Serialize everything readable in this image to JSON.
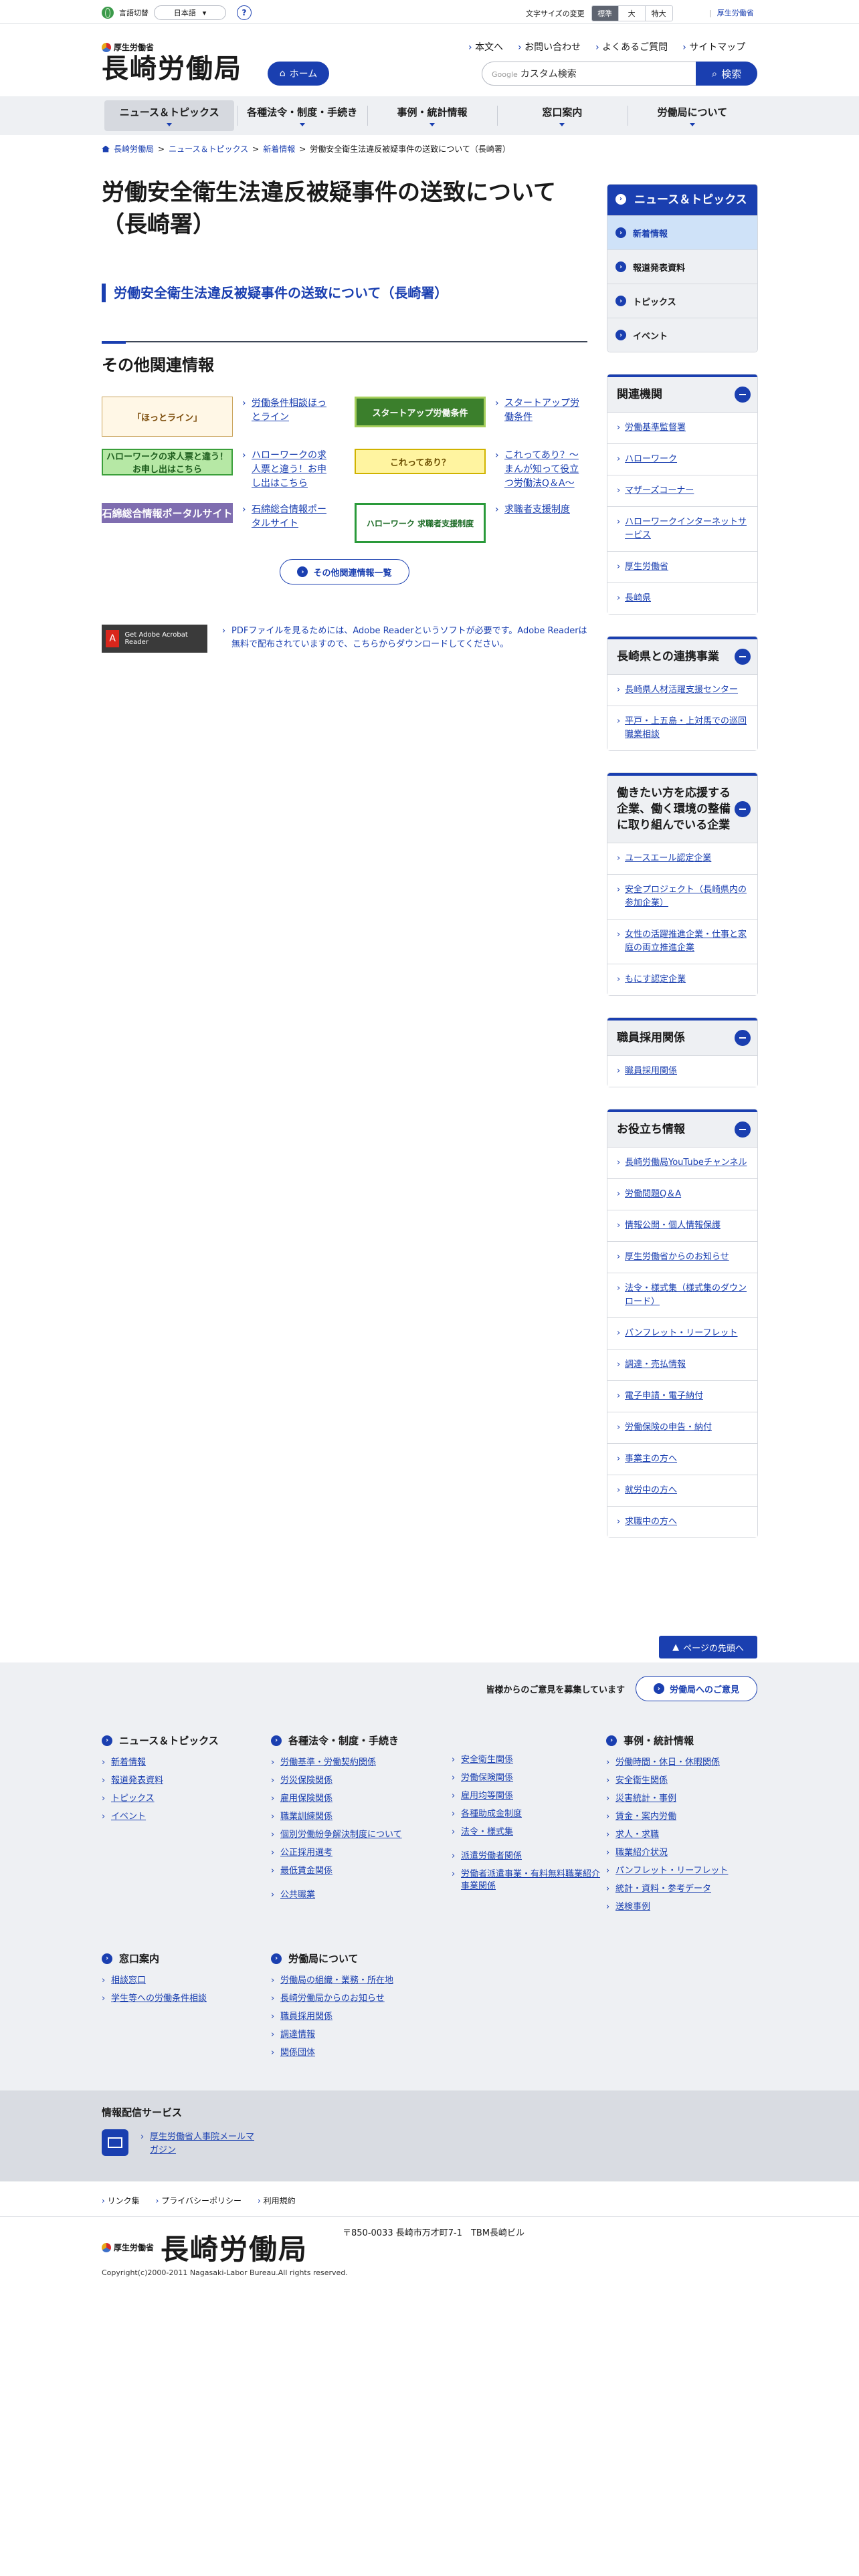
{
  "util": {
    "lang_label": "言語切替",
    "lang_value": "日本語",
    "help": "?",
    "fontsize_label": "文字サイズの変更",
    "fontsize_options": [
      "標準",
      "大",
      "特大"
    ],
    "mhlw": "厚生労働省"
  },
  "header": {
    "ministry": "厚生労働省",
    "bureau": "長崎労働局",
    "home": "ホーム",
    "links": [
      "本文へ",
      "お問い合わせ",
      "よくあるご質問",
      "サイトマップ"
    ],
    "search_brand": "Google",
    "search_placeholder": "カスタム検索",
    "search_button": "検索"
  },
  "gnav": [
    "ニュース＆トピックス",
    "各種法令・制度・手続き",
    "事例・統計情報",
    "窓口案内",
    "労働局について"
  ],
  "breadcrumb": [
    "長崎労働局",
    "ニュース＆トピックス",
    "新着情報",
    "労働安全衛生法違反被疑事件の送致について（長崎署）"
  ],
  "main": {
    "title": "労働安全衛生法違反被疑事件の送致について（長崎署）",
    "link": "労働安全衛生法違反被疑事件の送致について（長崎署）",
    "related_heading": "その他関連情報",
    "banners": [
      {
        "img": "「ほっとライン」",
        "link": "労働条件相談ほっとライン"
      },
      {
        "img": "スタートアップ労働条件",
        "link": "スタートアップ労働条件"
      },
      {
        "img": "ハローワークの求人票と違う！お申し出はこちら",
        "link": "ハローワークの求人票と違う！お申し出はこちら"
      },
      {
        "img": "これってあり？",
        "link": "これってあり？～まんが知って役立つ労働法Q＆A～"
      },
      {
        "img": "石綿総合情報ポータルサイト",
        "link": "石綿総合情報ポータルサイト"
      },
      {
        "img": "ハローワーク 求職者支援制度",
        "link": "求職者支援制度"
      }
    ],
    "more": "その他関連情報一覧",
    "adobe": "Get Adobe Acrobat Reader",
    "pdf_note": "PDFファイルを見るためには、Adobe Readerというソフトが必要です。Adobe Readerは無料で配布されていますので、こちらからダウンロードしてください。"
  },
  "side": {
    "news_title": "ニュース＆トピックス",
    "news_items": [
      "新着情報",
      "報道発表資料",
      "トピックス",
      "イベント"
    ],
    "boxes": [
      {
        "title": "関連機関",
        "items": [
          "労働基準監督署",
          "ハローワーク",
          "マザーズコーナー",
          "ハローワークインターネットサービス",
          "厚生労働省",
          "長崎県"
        ]
      },
      {
        "title": "長崎県との連携事業",
        "items": [
          "長崎県人材活躍支援センター",
          "平戸・上五島・上対馬での巡回職業相談"
        ]
      },
      {
        "title": "働きたい方を応援する企業、働く環境の整備に取り組んでいる企業",
        "items": [
          "ユースエール認定企業",
          "安全プロジェクト（長崎県内の参加企業）",
          "女性の活躍推進企業・仕事と家庭の両立推進企業",
          "もにす認定企業"
        ]
      },
      {
        "title": "職員採用関係",
        "items": [
          "職員採用関係"
        ]
      },
      {
        "title": "お役立ち情報",
        "items": [
          "長崎労働局YouTubeチャンネル",
          "労働問題Q＆A",
          "情報公開・個人情報保護",
          "厚生労働省からのお知らせ",
          "法令・様式集（様式集のダウンロード）",
          "パンフレット・リーフレット",
          "調達・売払情報",
          "電子申請・電子納付",
          "労働保険の申告・納付",
          "事業主の方へ",
          "就労中の方へ",
          "求職中の方へ"
        ]
      }
    ]
  },
  "pagetop": "ページの先頭へ",
  "footer": {
    "opinion_text": "皆様からのご意見を募集しています",
    "opinion_button": "労働局へのご意見",
    "nav": {
      "news": {
        "title": "ニュース＆トピックス",
        "items": [
          "新着情報",
          "報道発表資料",
          "トピックス",
          "イベント"
        ]
      },
      "law": {
        "title": "各種法令・制度・手続き",
        "items_a": [
          "労働基準・労働契約関係",
          "労災保険関係",
          "雇用保険関係",
          "職業訓練関係",
          "個別労働紛争解決制度について",
          "公正採用選考",
          "最低賃金関係",
          "公共職業"
        ],
        "items_b": [
          "安全衛生関係",
          "労働保険関係",
          "雇用均等関係",
          "各種助成金制度",
          "法令・様式集",
          "派遣労働者関係",
          "労働者派遣事業・有料無料職業紹介事業関係"
        ]
      },
      "stats": {
        "title": "事例・統計情報",
        "items": [
          "労働時間・休日・休暇関係",
          "安全衛生関係",
          "災害統計・事例",
          "賃金・案内労働",
          "求人・求職",
          "職業紹介状況",
          "パンフレット・リーフレット",
          "統計・資料・参考データ",
          "送検事例"
        ]
      },
      "window": {
        "title": "窓口案内",
        "items": [
          "相談窓口",
          "学生等への労働条件相談"
        ]
      },
      "about": {
        "title": "労働局について",
        "items": [
          "労働局の組織・業務・所在地",
          "長崎労働局からのお知らせ",
          "職員採用関係",
          "調達情報",
          "関係団体"
        ]
      }
    },
    "info_title": "情報配信サービス",
    "info_link": "厚生労働省人事院メールマガジン",
    "links": [
      "リンク集",
      "プライバシーポリシー",
      "利用規約"
    ],
    "ministry": "厚生労働省",
    "bureau": "長崎労働局",
    "address": "〒850-0033 長崎市万才町7-1　TBM長崎ビル",
    "copyright": "Copyright(c)2000-2011 Nagasaki-Labor Bureau.All rights reserved."
  }
}
